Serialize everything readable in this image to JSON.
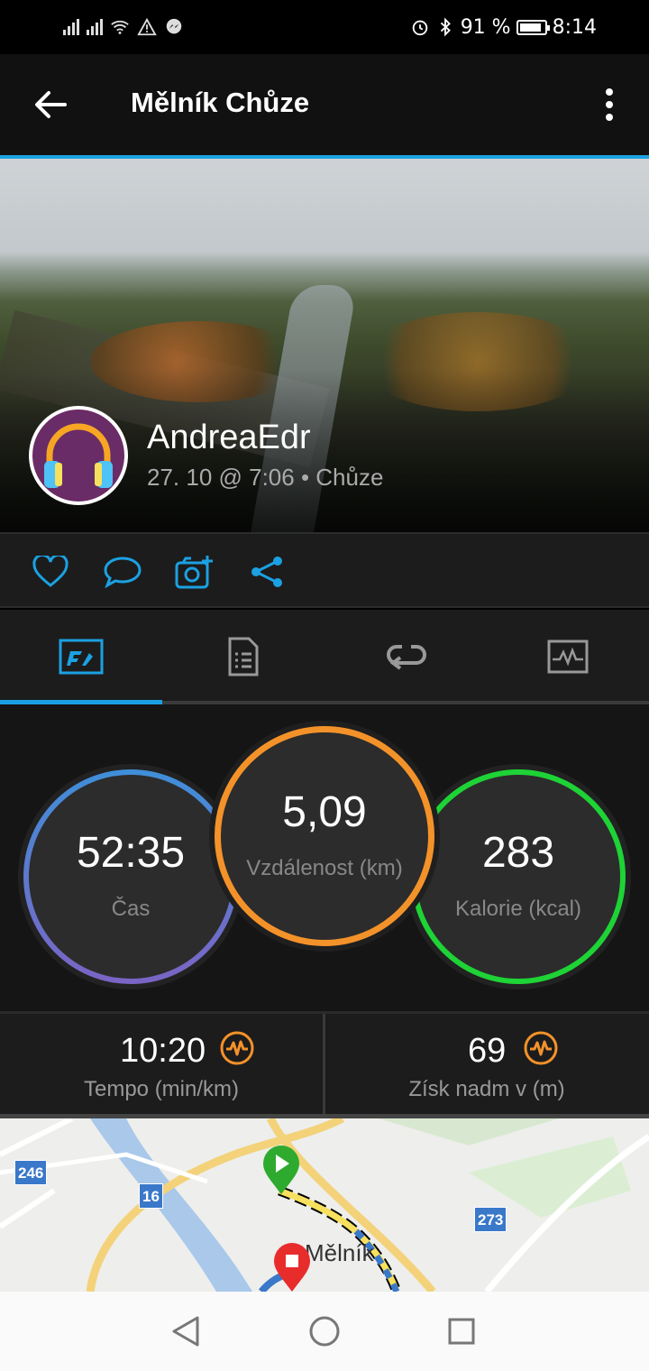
{
  "status_bar": {
    "battery_percent": "91 %",
    "time": "8:14",
    "battery_level": 0.91
  },
  "app_bar": {
    "title": "Mělník Chůze"
  },
  "post": {
    "user_name": "AndreaEdr",
    "meta": "27. 10 @ 7:06 • Chůze"
  },
  "tabs": [
    {
      "icon": "stats-overview-icon",
      "active": true
    },
    {
      "icon": "details-list-icon",
      "active": false
    },
    {
      "icon": "laps-icon",
      "active": false
    },
    {
      "icon": "charts-icon",
      "active": false
    }
  ],
  "stats": {
    "time": {
      "value": "52:35",
      "label": "Čas"
    },
    "distance": {
      "value": "5,09",
      "label": "Vzdálenost (km)"
    },
    "calories": {
      "value": "283",
      "label": "Kalorie (kcal)"
    }
  },
  "sub_stats": {
    "pace": {
      "value": "10:20",
      "label": "Tempo (min/km)"
    },
    "elevation": {
      "value": "69",
      "label": "Získ nadm v (m)"
    }
  },
  "map": {
    "town": "Mělník",
    "routes": [
      "246",
      "16",
      "273"
    ]
  },
  "colors": {
    "accent": "#1ba1e2",
    "distance_ring": "#f4922a",
    "calories_ring": "#1ed336",
    "time_ring_top": "#3f8fd9",
    "time_ring_bottom": "#7b64c4",
    "pulse_icon": "#f4922a"
  }
}
